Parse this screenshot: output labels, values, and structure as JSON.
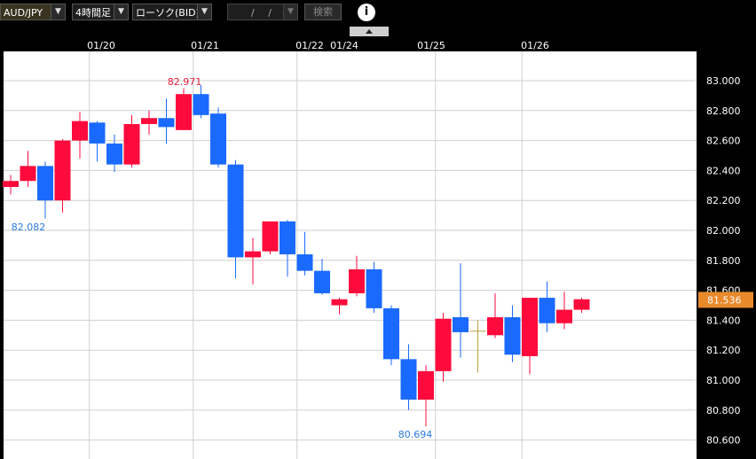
{
  "toolbar": {
    "pair": "AUD/JPY",
    "timeframe": "4時間足",
    "chart_type": "ローソク(BID)",
    "date_value": "/ /",
    "search_label": "検索",
    "info_label": "i"
  },
  "colors": {
    "up": "#ff0a3c",
    "down": "#1a6aff",
    "doji": "#b8a040",
    "current_price_bg": "#e8892a"
  },
  "chart_data": {
    "type": "candlestick",
    "ylim": [
      80.6,
      83.1
    ],
    "y_ticks": [
      "83.000",
      "82.800",
      "82.600",
      "82.400",
      "82.200",
      "82.000",
      "81.800",
      "81.600",
      "81.400",
      "81.200",
      "81.000",
      "80.800",
      "80.600"
    ],
    "x_labels": [
      "01/20",
      "01/21",
      "01/22",
      "01/24",
      "01/25",
      "01/26"
    ],
    "current_price": "81.536",
    "annotations": {
      "high": "82.971",
      "low": "80.694",
      "left_low": "82.082"
    },
    "candles": [
      {
        "o": 82.29,
        "h": 82.37,
        "l": 82.24,
        "c": 82.33
      },
      {
        "o": 82.33,
        "h": 82.53,
        "l": 82.29,
        "c": 82.43
      },
      {
        "o": 82.43,
        "h": 82.46,
        "l": 82.08,
        "c": 82.2
      },
      {
        "o": 82.2,
        "h": 82.61,
        "l": 82.12,
        "c": 82.6
      },
      {
        "o": 82.6,
        "h": 82.79,
        "l": 82.48,
        "c": 82.73
      },
      {
        "o": 82.72,
        "h": 82.73,
        "l": 82.46,
        "c": 82.58
      },
      {
        "o": 82.58,
        "h": 82.64,
        "l": 82.39,
        "c": 82.44
      },
      {
        "o": 82.44,
        "h": 82.77,
        "l": 82.42,
        "c": 82.71
      },
      {
        "o": 82.71,
        "h": 82.8,
        "l": 82.64,
        "c": 82.75
      },
      {
        "o": 82.75,
        "h": 82.88,
        "l": 82.58,
        "c": 82.69
      },
      {
        "o": 82.67,
        "h": 82.95,
        "l": 82.67,
        "c": 82.91
      },
      {
        "o": 82.91,
        "h": 82.97,
        "l": 82.75,
        "c": 82.77
      },
      {
        "o": 82.78,
        "h": 82.82,
        "l": 82.42,
        "c": 82.44
      },
      {
        "o": 82.44,
        "h": 82.47,
        "l": 81.68,
        "c": 81.82
      },
      {
        "o": 81.82,
        "h": 81.95,
        "l": 81.64,
        "c": 81.86
      },
      {
        "o": 81.86,
        "h": 82.06,
        "l": 81.84,
        "c": 82.06
      },
      {
        "o": 82.06,
        "h": 82.07,
        "l": 81.69,
        "c": 81.84
      },
      {
        "o": 81.84,
        "h": 81.99,
        "l": 81.7,
        "c": 81.73
      },
      {
        "o": 81.73,
        "h": 81.81,
        "l": 81.57,
        "c": 81.58
      },
      {
        "o": 81.5,
        "h": 81.55,
        "l": 81.44,
        "c": 81.54
      },
      {
        "o": 81.58,
        "h": 81.83,
        "l": 81.56,
        "c": 81.74
      },
      {
        "o": 81.74,
        "h": 81.79,
        "l": 81.45,
        "c": 81.48
      },
      {
        "o": 81.48,
        "h": 81.5,
        "l": 81.1,
        "c": 81.14
      },
      {
        "o": 81.14,
        "h": 81.24,
        "l": 80.8,
        "c": 80.87
      },
      {
        "o": 80.87,
        "h": 81.1,
        "l": 80.69,
        "c": 81.06
      },
      {
        "o": 81.06,
        "h": 81.45,
        "l": 80.99,
        "c": 81.41
      },
      {
        "o": 81.42,
        "h": 81.78,
        "l": 81.15,
        "c": 81.32
      },
      {
        "o": 81.33,
        "h": 81.4,
        "l": 81.05,
        "c": 81.33
      },
      {
        "o": 81.3,
        "h": 81.58,
        "l": 81.28,
        "c": 81.42
      },
      {
        "o": 81.42,
        "h": 81.5,
        "l": 81.12,
        "c": 81.17
      },
      {
        "o": 81.16,
        "h": 81.55,
        "l": 81.04,
        "c": 81.55
      },
      {
        "o": 81.55,
        "h": 81.66,
        "l": 81.32,
        "c": 81.38
      },
      {
        "o": 81.38,
        "h": 81.59,
        "l": 81.34,
        "c": 81.47
      },
      {
        "o": 81.47,
        "h": 81.55,
        "l": 81.45,
        "c": 81.54
      }
    ]
  }
}
